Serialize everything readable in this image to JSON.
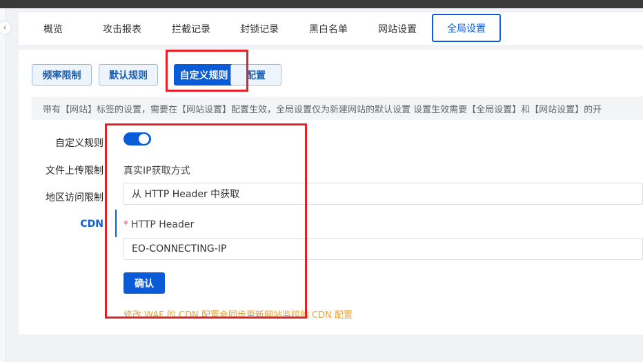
{
  "tabs": [
    {
      "label": "概览",
      "active": false
    },
    {
      "label": "攻击报表",
      "active": false
    },
    {
      "label": "拦截记录",
      "active": false
    },
    {
      "label": "封锁记录",
      "active": false
    },
    {
      "label": "黑白名单",
      "active": false
    },
    {
      "label": "网站设置",
      "active": false
    },
    {
      "label": "全局设置",
      "active": true
    }
  ],
  "subtabs": [
    {
      "label": "频率限制",
      "active": false
    },
    {
      "label": "默认规则",
      "active": false
    },
    {
      "label": "自定义规则",
      "active": true
    },
    {
      "label": "配置",
      "active": false
    }
  ],
  "notice": "带有【网站】标签的设置，需要在【网站设置】配置生效，全局设置仅为新建网站的默认设置 设置生效需要【全局设置】和【网站设置】的开",
  "side_menu": [
    {
      "label": "自定义规则"
    },
    {
      "label": "文件上传限制"
    },
    {
      "label": "地区访问限制"
    },
    {
      "label": "CDN",
      "active": true
    }
  ],
  "form": {
    "toggle_on": true,
    "ip_mode_label": "真实IP获取方式",
    "ip_mode_value": "从 HTTP Header 中获取",
    "header_required_mark": "*",
    "header_label": "HTTP Header",
    "header_value": "EO-CONNECTING-IP",
    "confirm_label": "确认",
    "warning": "修改 WAF 的 CDN 配置会同步更新网站监控的 CDN 配置"
  },
  "colors": {
    "primary": "#0a5bd8",
    "highlight_box": "#e52027",
    "warning_text": "#e6a23c"
  },
  "icons": {
    "collapse": "chevron-left-icon"
  }
}
